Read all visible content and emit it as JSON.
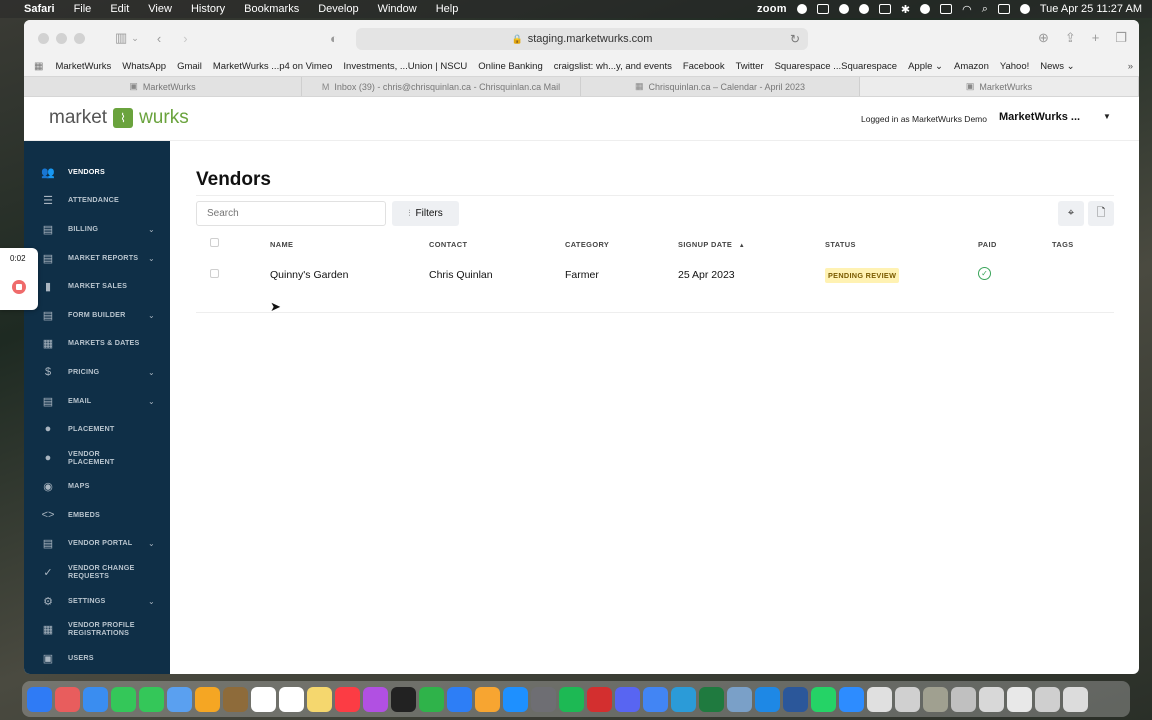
{
  "menubar": {
    "app": "Safari",
    "items": [
      "File",
      "Edit",
      "View",
      "History",
      "Bookmarks",
      "Develop",
      "Window",
      "Help"
    ],
    "zoom_label": "zoom",
    "datetime": "Tue Apr 25  11:27 AM"
  },
  "browser": {
    "url": "staging.marketwurks.com",
    "favorites": [
      "MarketWurks",
      "WhatsApp",
      "Gmail",
      "MarketWurks ...p4 on Vimeo",
      "Investments, ...Union | NSCU",
      "Online Banking",
      "craigslist: wh...y, and events",
      "Facebook",
      "Twitter",
      "Squarespace ...Squarespace",
      "Apple ⌄",
      "Amazon",
      "Yahoo!",
      "News ⌄"
    ],
    "tabs": [
      "MarketWurks",
      "Inbox (39) - chris@chrisquinlan.ca - Chrisquinlan.ca Mail",
      "Chrisquinlan.ca – Calendar - April 2023",
      "MarketWurks"
    ]
  },
  "header": {
    "logo_left": "market",
    "logo_right": "wurks",
    "logged_in": "Logged in as MarketWurks Demo",
    "account": "MarketWurks ..."
  },
  "sidebar": {
    "items": [
      {
        "label": "VENDORS",
        "icon": "users-icon",
        "glyph": "👥",
        "caret": false,
        "active": true
      },
      {
        "label": "ATTENDANCE",
        "icon": "checklist-icon",
        "glyph": "☰",
        "caret": false
      },
      {
        "label": "BILLING",
        "icon": "document-icon",
        "glyph": "▤",
        "caret": true
      },
      {
        "label": "MARKET REPORTS",
        "icon": "document-icon",
        "glyph": "▤",
        "caret": true
      },
      {
        "label": "MARKET SALES",
        "icon": "bar-chart-icon",
        "glyph": "▮",
        "caret": false
      },
      {
        "label": "FORM BUILDER",
        "icon": "document-icon",
        "glyph": "▤",
        "caret": true
      },
      {
        "label": "MARKETS & DATES",
        "icon": "calendar-icon",
        "glyph": "▦",
        "caret": false
      },
      {
        "label": "PRICING",
        "icon": "dollar-icon",
        "glyph": "$",
        "caret": true
      },
      {
        "label": "EMAIL",
        "icon": "document-icon",
        "glyph": "▤",
        "caret": true
      },
      {
        "label": "PLACEMENT",
        "icon": "map-pin-icon",
        "glyph": "●",
        "caret": false
      },
      {
        "label": "VENDOR PLACEMENT",
        "icon": "map-pin-icon",
        "glyph": "●",
        "caret": false
      },
      {
        "label": "MAPS",
        "icon": "compass-icon",
        "glyph": "◉",
        "caret": false
      },
      {
        "label": "EMBEDS",
        "icon": "code-icon",
        "glyph": "<>",
        "caret": false
      },
      {
        "label": "VENDOR PORTAL",
        "icon": "newspaper-icon",
        "glyph": "▤",
        "caret": true
      },
      {
        "label": "VENDOR CHANGE REQUESTS",
        "icon": "check-icon",
        "glyph": "✓",
        "caret": false
      },
      {
        "label": "SETTINGS",
        "icon": "gear-icon",
        "glyph": "⚙",
        "caret": true
      },
      {
        "label": "VENDOR PROFILE REGISTRATIONS",
        "icon": "register-icon",
        "glyph": "▦",
        "caret": false
      },
      {
        "label": "USERS",
        "icon": "user-card-icon",
        "glyph": "▣",
        "caret": false
      }
    ]
  },
  "main": {
    "title": "Vendors",
    "search_placeholder": "Search",
    "filters_label": "Filters",
    "columns": {
      "name": "NAME",
      "contact": "CONTACT",
      "category": "CATEGORY",
      "signup": "SIGNUP DATE",
      "signup_sort": "▲",
      "status": "STATUS",
      "paid": "PAID",
      "tags": "TAGS"
    },
    "rows": [
      {
        "name": "Quinny's Garden",
        "contact": "Chris Quinlan",
        "category": "Farmer",
        "signup": "25 Apr 2023",
        "status": "PENDING REVIEW",
        "paid": true
      }
    ]
  },
  "recorder": {
    "time": "0:02"
  },
  "colors": {
    "sidebar_bg": "#0f2f47",
    "brand_green": "#6aa33d",
    "active_icon": "#4e8fd6",
    "badge_bg": "#fff2b3",
    "paid_green": "#3aa55a"
  }
}
